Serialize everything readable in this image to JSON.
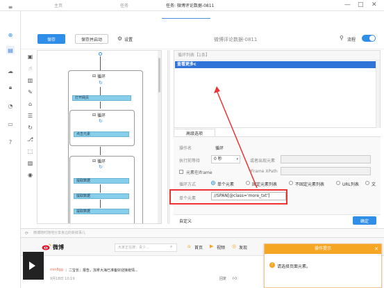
{
  "tabs": [
    {
      "label": "主页"
    },
    {
      "label": "任务"
    },
    {
      "label": "任务: 微博评论数据-0811"
    }
  ],
  "window_controls": {
    "minimize": "—",
    "maximize": "□",
    "close": "✕"
  },
  "toolbar": {
    "save_label": "保存",
    "save_run_label": "保存并启动",
    "settings_label": "设置",
    "task_title": "微博评论数据-0811",
    "flow_label": "流程"
  },
  "flow": {
    "loop_outer_title": "循环",
    "open_page_label": "打开网页",
    "loop_inner1_title": "循环",
    "click_element_label": "点击元素",
    "loop_inner2_title": "循环",
    "extract1": "提取数据",
    "extract2": "提取数据",
    "extract3": "提取数据"
  },
  "loop_list": {
    "header": "循环列表【1条】",
    "selected_item": "查看更多c"
  },
  "advanced": {
    "tab_label": "高级选项",
    "op_name_label": "操作名",
    "op_name_value": "循环",
    "wait_label": "执行前等待",
    "wait_value": "0 秒",
    "or_appear_label": "或者出现元素",
    "iframe_label": "元素在Iframe",
    "iframe_xpath_label": "IFrame XPath",
    "loop_mode_label": "循环方式",
    "modes": [
      "单个元素",
      "固定元素列表",
      "不固定元素列表",
      "URL列表",
      "文"
    ],
    "single_element_label": "单个元素",
    "xpath_value": "//SPAN[@class='more_txt']",
    "custom_label": "自定义",
    "confirm_label": "确定"
  },
  "url_bar": {
    "placeholder": "微博随时随地分享身边的新鲜事儿"
  },
  "weibo": {
    "brand": "微博",
    "search_placeholder": "大家正在搜：青少...",
    "nav": [
      "首页",
      "视频",
      "发现"
    ],
    "comment_user": "min8gg",
    "comment_text": "：二宝长：报告，加拿大海已准备好迎接疫情...",
    "comment_date": "9月18日 10:19",
    "report_label": "回复"
  },
  "popup": {
    "title": "操作提示",
    "message": "请选择页面元素。"
  },
  "colors": {
    "accent": "#2f8ee7",
    "selection": "#2f72d8",
    "flow_step": "#87ceeb",
    "highlight": "#ee3333",
    "popup": "#f5a623"
  }
}
